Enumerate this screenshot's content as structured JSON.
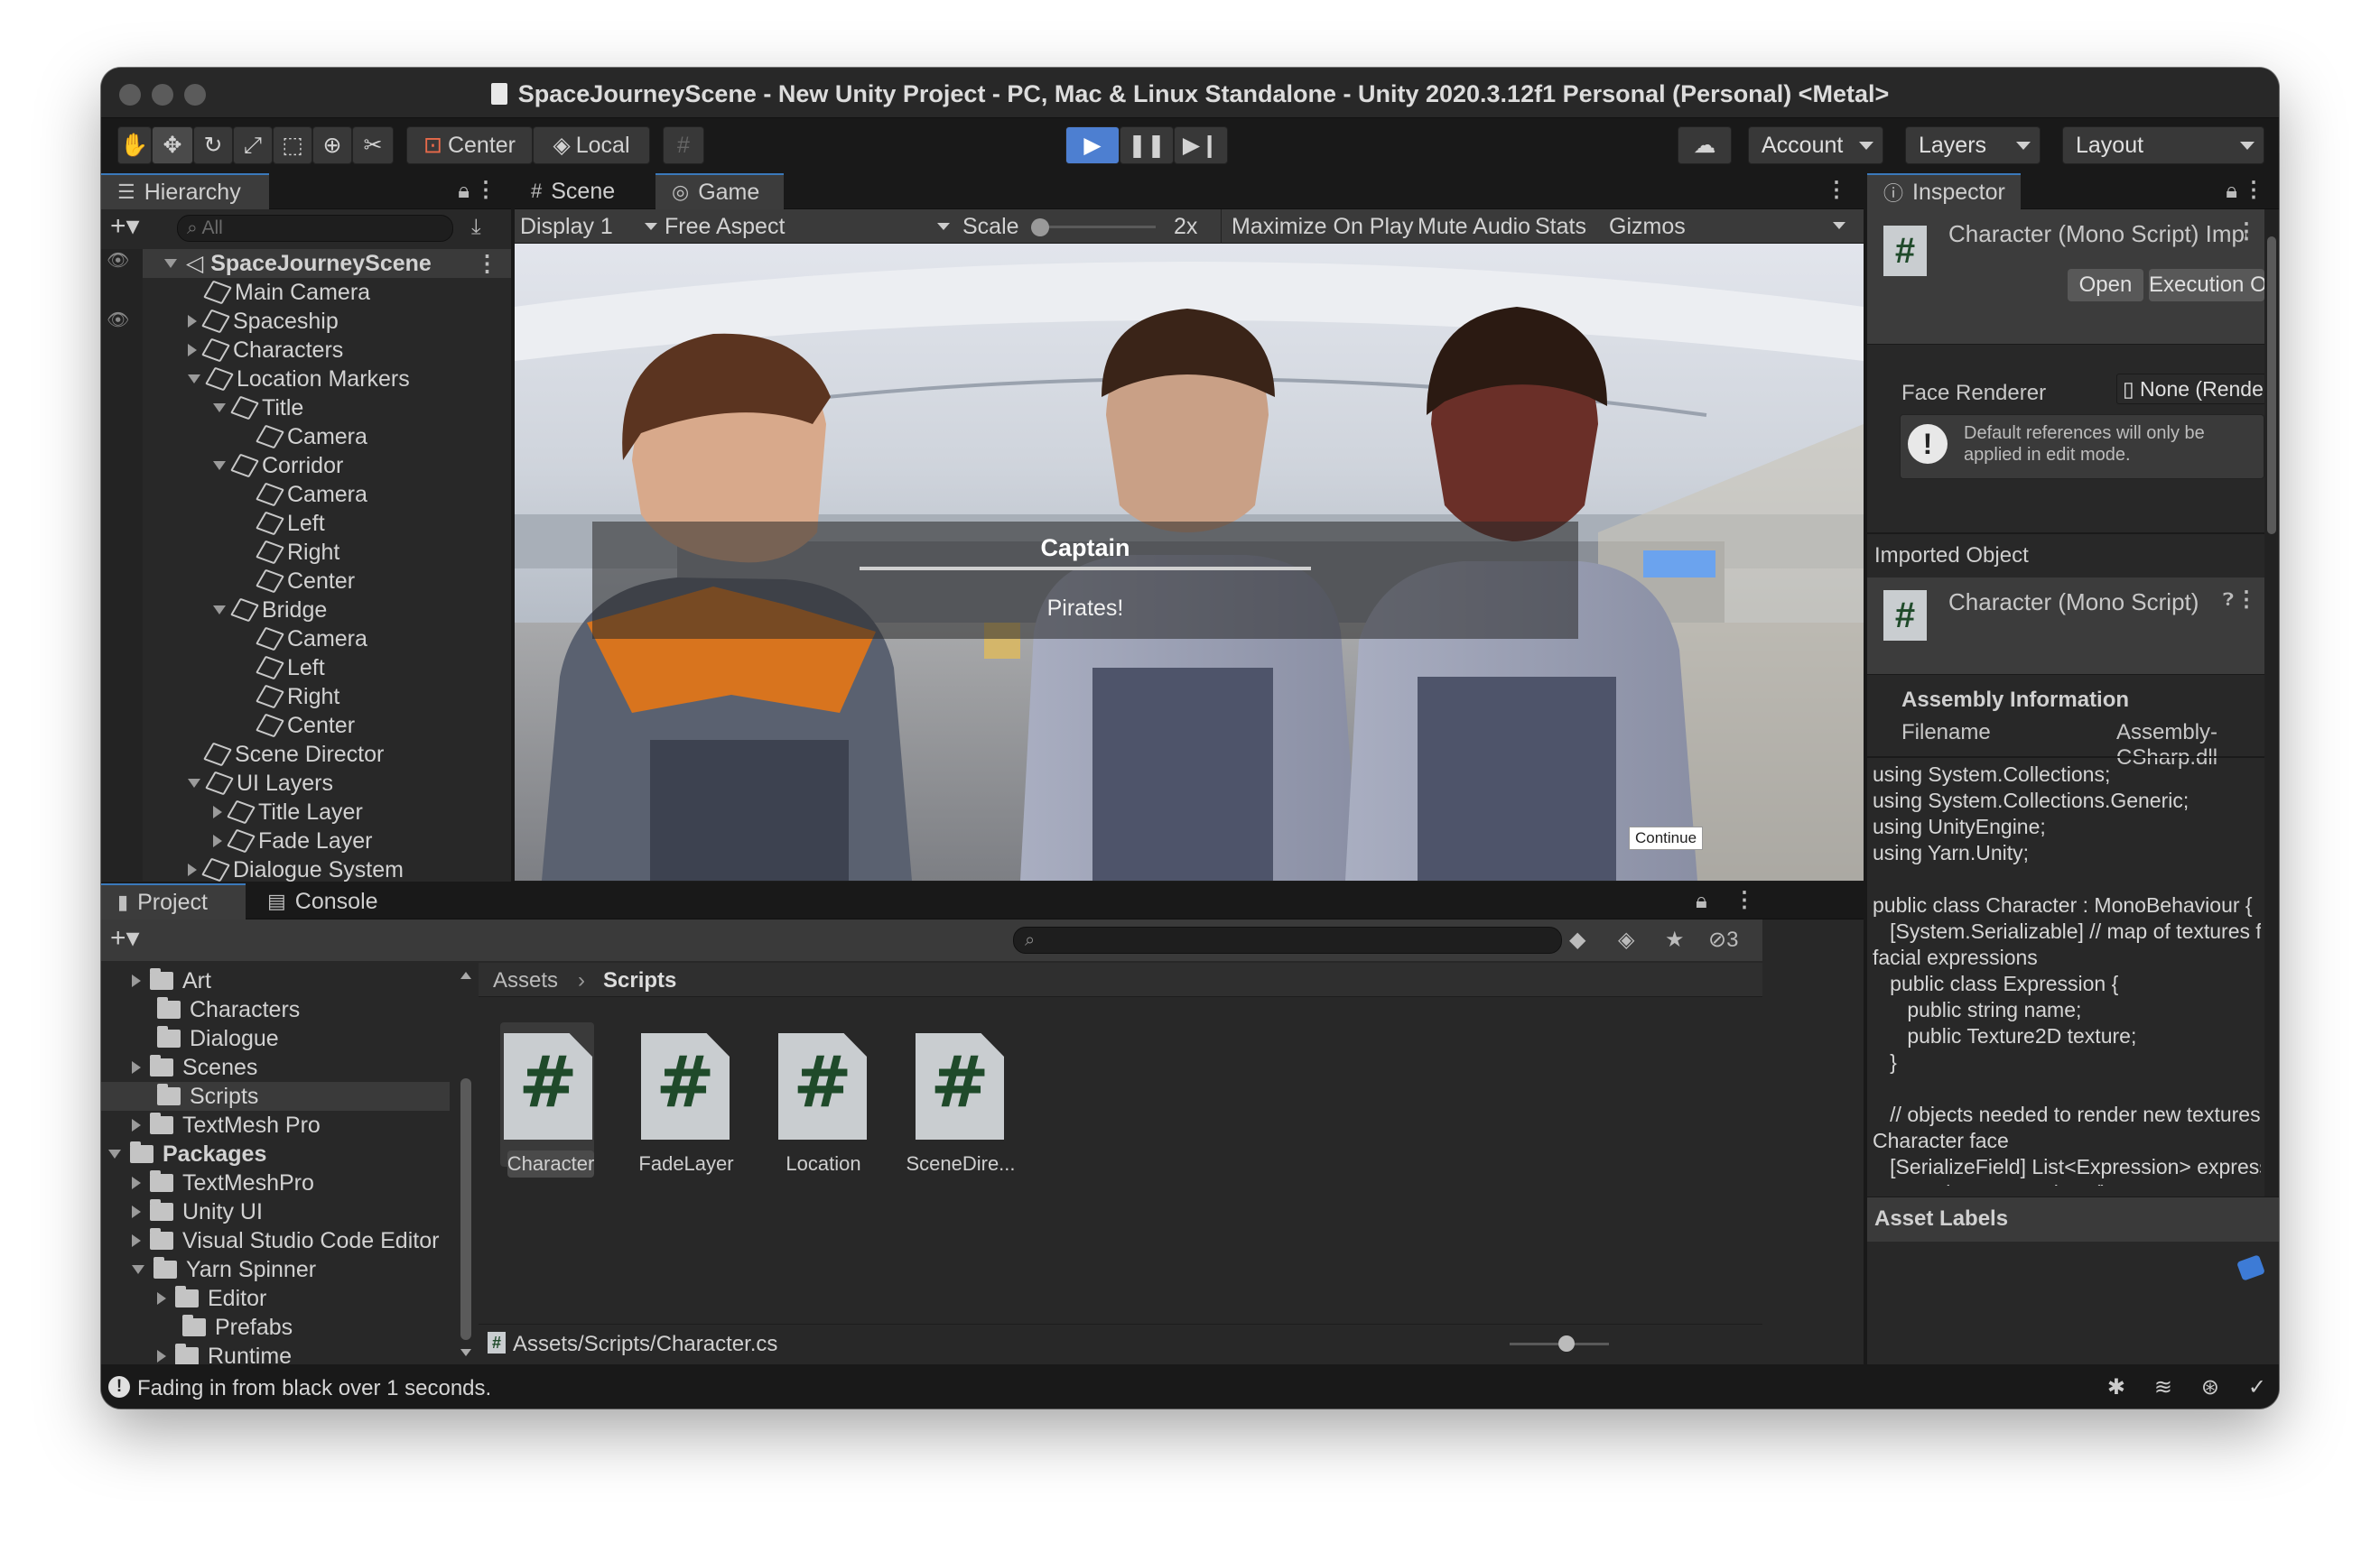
{
  "window": {
    "title": "SpaceJourneyScene - New Unity Project - PC, Mac & Linux Standalone - Unity 2020.3.12f1 Personal (Personal) <Metal>"
  },
  "toolbar": {
    "center_label": "Center",
    "local_label": "Local",
    "account_label": "Account",
    "layers_label": "Layers",
    "layout_label": "Layout"
  },
  "hierarchy": {
    "tab_label": "Hierarchy",
    "search_placeholder": "All",
    "items": [
      {
        "label": "SpaceJourneyScene"
      },
      {
        "label": "Main Camera"
      },
      {
        "label": "Spaceship"
      },
      {
        "label": "Characters"
      },
      {
        "label": "Location Markers"
      },
      {
        "label": "Title"
      },
      {
        "label": "Camera"
      },
      {
        "label": "Corridor"
      },
      {
        "label": "Camera"
      },
      {
        "label": "Left"
      },
      {
        "label": "Right"
      },
      {
        "label": "Center"
      },
      {
        "label": "Bridge"
      },
      {
        "label": "Camera"
      },
      {
        "label": "Left"
      },
      {
        "label": "Right"
      },
      {
        "label": "Center"
      },
      {
        "label": "Scene Director"
      },
      {
        "label": "UI Layers"
      },
      {
        "label": "Title Layer"
      },
      {
        "label": "Fade Layer"
      },
      {
        "label": "Dialogue System"
      }
    ]
  },
  "game_view": {
    "tab_scene": "Scene",
    "tab_game": "Game",
    "display_label": "Display 1",
    "aspect_label": "Free Aspect",
    "scale_label": "Scale",
    "scale_value": "2x",
    "maximize_label": "Maximize On Play",
    "mute_label": "Mute Audio",
    "stats_label": "Stats",
    "gizmos_label": "Gizmos",
    "dialogue_speaker": "Captain",
    "dialogue_line": "Pirates!",
    "continue_label": "Continue"
  },
  "project": {
    "tab_project": "Project",
    "tab_console": "Console",
    "hidden_count": "3",
    "tree": [
      {
        "label": "Art"
      },
      {
        "label": "Characters"
      },
      {
        "label": "Dialogue"
      },
      {
        "label": "Scenes"
      },
      {
        "label": "Scripts"
      },
      {
        "label": "TextMesh Pro"
      },
      {
        "label": "Packages"
      },
      {
        "label": "TextMeshPro"
      },
      {
        "label": "Unity UI"
      },
      {
        "label": "Visual Studio Code Editor"
      },
      {
        "label": "Yarn Spinner"
      },
      {
        "label": "Editor"
      },
      {
        "label": "Prefabs"
      },
      {
        "label": "Runtime"
      }
    ],
    "breadcrumb_root": "Assets",
    "breadcrumb_current": "Scripts",
    "assets": [
      {
        "label": "Character"
      },
      {
        "label": "FadeLayer"
      },
      {
        "label": "Location"
      },
      {
        "label": "SceneDire..."
      }
    ],
    "path": "Assets/Scripts/Character.cs"
  },
  "inspector": {
    "tab_label": "Inspector",
    "header_title": "Character (Mono Script) Impor",
    "open_label": "Open",
    "execution_order_label": "Execution Order...",
    "face_renderer_label": "Face Renderer",
    "face_renderer_value": "None (Renderer)",
    "warning_text": "Default references will only be applied in edit mode.",
    "imported_object_label": "Imported Object",
    "imported_title": "Character (Mono Script)",
    "assembly_header": "Assembly Information",
    "filename_label": "Filename",
    "filename_value": "Assembly-CSharp.dll",
    "code": "using System.Collections;\nusing System.Collections.Generic;\nusing UnityEngine;\nusing Yarn.Unity;\n\npublic class Character : MonoBehaviour {\n   [System.Serializable] // map of textures for\nfacial expressions\n   public class Expression {\n      public string name;\n      public Texture2D texture;\n   }\n\n   // objects needed to render new textures on\nCharacter face\n   [SerializeField] List<Expression> expressions\n= new List<Expression>();\n   [SerializeField] Renderer faceRenderer;\n   [SerializeField] int faceMaterialIndex;\n\n   // object needed to set Character pose\n   private Animator animator;",
    "asset_labels": "Asset Labels"
  },
  "status": {
    "message": "Fading in from black over 1 seconds."
  },
  "colors": {
    "play_blue": "#4d7fd1",
    "selection": "#2c5d87",
    "script_green": "#1f4a2a"
  }
}
